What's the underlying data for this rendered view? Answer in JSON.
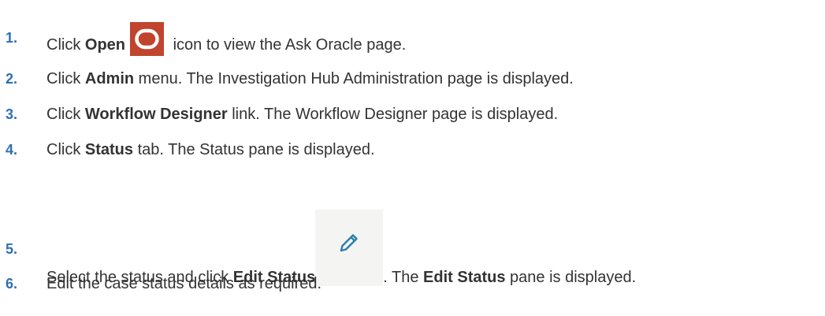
{
  "colors": {
    "step_number": "#2f6fb0",
    "text": "#333333",
    "open_icon_bg": "#c0442e",
    "open_icon_ring": "#ffffff",
    "edit_icon_bg": "#f4f4f3",
    "edit_icon_stroke": "#2a7fa8"
  },
  "icons": {
    "open": "oracle-open-icon",
    "edit": "pencil-icon"
  },
  "steps": [
    {
      "number": "1.",
      "pre": "Click ",
      "bold1": "Open",
      "post1": " icon to view the Ask Oracle page."
    },
    {
      "number": "2.",
      "pre": "Click ",
      "bold1": "Admin",
      "post1": " menu. The Investigation Hub Administration page is displayed."
    },
    {
      "number": "3.",
      "pre": "Click ",
      "bold1": "Workflow Designer",
      "post1": " link. The Workflow Designer page is displayed."
    },
    {
      "number": "4.",
      "pre": "Click ",
      "bold1": "Status",
      "post1": " tab. The Status pane is displayed."
    },
    {
      "number": "5.",
      "pre": "Select the status and click ",
      "bold1": "Edit Status",
      "mid": ". The ",
      "bold2": "Edit Status",
      "post1": " pane is displayed."
    },
    {
      "number": "6.",
      "pre": "Edit the case status details as required."
    }
  ]
}
